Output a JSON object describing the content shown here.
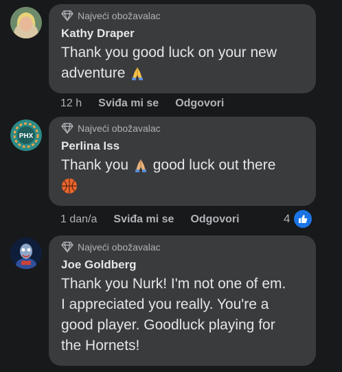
{
  "comments": [
    {
      "badge": "Najveći obožavalac",
      "author": "Kathy Draper",
      "text_1": "Thank you good luck on your new",
      "text_2": "adventure",
      "time": "12 h",
      "like_label": "Sviđa mi se",
      "reply_label": "Odgovori"
    },
    {
      "badge": "Najveći obožavalac",
      "author": "Perlina Iss",
      "text_a": "Thank you",
      "text_b": "good luck out there",
      "avatar_text": "PHX",
      "time": "1 dan/a",
      "like_label": "Sviđa mi se",
      "reply_label": "Odgovori",
      "reaction_count": "4"
    },
    {
      "badge": "Najveći obožavalac",
      "author": "Joe Goldberg",
      "text_lines": [
        "Thank you Nurk! I'm not one of em.",
        "I appreciated you really. You're a",
        "good player. Goodluck playing for",
        "the Hornets!"
      ]
    }
  ],
  "colors": {
    "background": "#18191a",
    "bubble": "#3a3b3c",
    "like_blue": "#1b74e4"
  },
  "icons": [
    "diamond-badge-icon",
    "folded-hands-emoji",
    "basketball-emoji",
    "like-thumb-icon"
  ]
}
